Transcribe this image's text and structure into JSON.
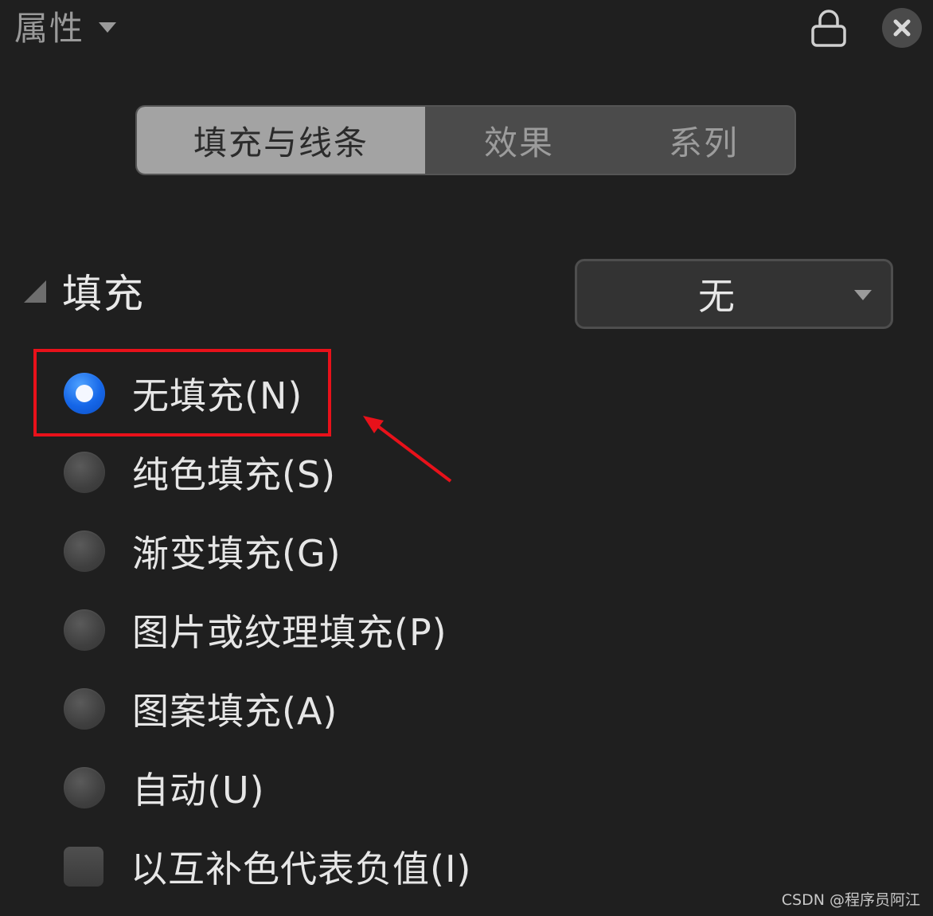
{
  "header": {
    "title": "属性"
  },
  "tabs": [
    {
      "label": "填充与线条",
      "active": true
    },
    {
      "label": "效果",
      "active": false
    },
    {
      "label": "系列",
      "active": false
    }
  ],
  "fill_section": {
    "label": "填充",
    "dropdown_value": "无"
  },
  "options": [
    {
      "label": "无填充(N)",
      "type": "radio",
      "checked": true
    },
    {
      "label": "纯色填充(S)",
      "type": "radio",
      "checked": false
    },
    {
      "label": "渐变填充(G)",
      "type": "radio",
      "checked": false
    },
    {
      "label": "图片或纹理填充(P)",
      "type": "radio",
      "checked": false
    },
    {
      "label": "图案填充(A)",
      "type": "radio",
      "checked": false
    },
    {
      "label": "自动(U)",
      "type": "radio",
      "checked": false
    },
    {
      "label": "以互补色代表负值(I)",
      "type": "checkbox",
      "checked": false
    }
  ],
  "watermark": "CSDN @程序员阿江",
  "colors": {
    "background": "#1f1f1f",
    "accent": "#1566e8",
    "annotation": "#e8111a"
  },
  "icons": [
    "chevron-down-icon",
    "lock-icon",
    "close-icon",
    "collapse-triangle-icon",
    "annotation-arrow"
  ]
}
